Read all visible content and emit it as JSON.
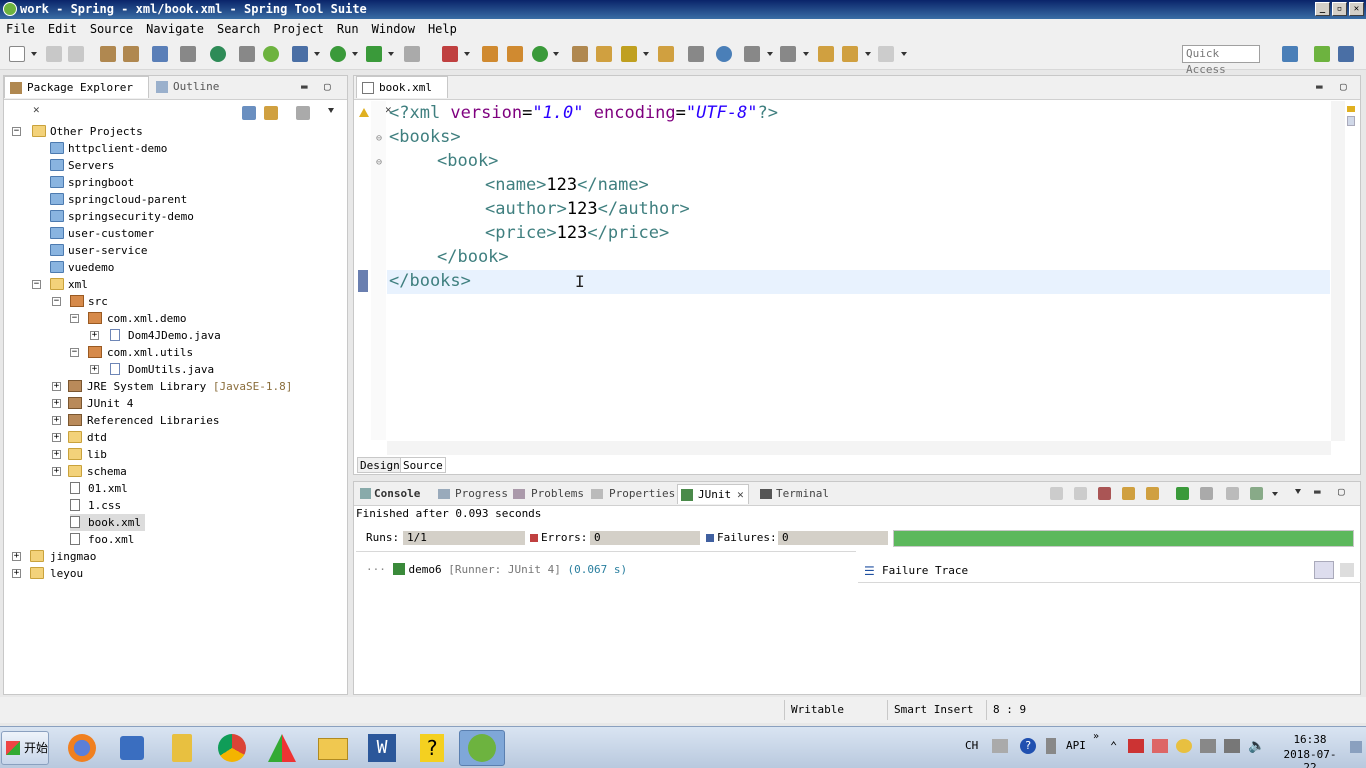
{
  "window": {
    "title": "work - Spring - xml/book.xml - Spring Tool Suite"
  },
  "menu": [
    "File",
    "Edit",
    "Source",
    "Navigate",
    "Search",
    "Project",
    "Run",
    "Window",
    "Help"
  ],
  "toolbar": {
    "quick_access_placeholder": "Quick Access"
  },
  "package_explorer": {
    "tab_label": "Package Explorer",
    "outline_label": "Outline",
    "tree": {
      "other_projects": "Other Projects",
      "httpclient": "httpclient-demo",
      "servers": "Servers",
      "springboot": "springboot",
      "springcloud": "springcloud-parent",
      "springsecurity": "springsecurity-demo",
      "user_customer": "user-customer",
      "user_service": "user-service",
      "vuedemo": "vuedemo",
      "xml": "xml",
      "src": "src",
      "pkg_demo": "com.xml.demo",
      "dom4j": "Dom4JDemo.java",
      "pkg_utils": "com.xml.utils",
      "domutils": "DomUtils.java",
      "jre": "JRE System Library",
      "jre_version": "[JavaSE-1.8]",
      "junit": "JUnit 4",
      "reflibs": "Referenced Libraries",
      "dtd": "dtd",
      "lib": "lib",
      "schema": "schema",
      "f01": "01.xml",
      "css": "1.css",
      "book": "book.xml",
      "foo": "foo.xml",
      "jingmao": "jingmao",
      "leyou": "leyou"
    }
  },
  "editor": {
    "tab_label": "book.xml",
    "lines": {
      "l1_open": "<?xml ",
      "l1_attr1": "version",
      "l1_eq1": "=",
      "l1_val1": "\"1.0\"",
      "l1_attr2": " encoding",
      "l1_eq2": "=",
      "l1_val2": "\"UTF-8\"",
      "l1_close": "?>",
      "l2": "<books>",
      "l3": "<book>",
      "l4_open": "<name>",
      "l4_text": "123",
      "l4_close": "</name>",
      "l5_open": "<author>",
      "l5_text": "123",
      "l5_close": "</author>",
      "l6_open": "<price>",
      "l6_text": "123",
      "l6_close": "</price>",
      "l7": "</book>",
      "l8": "</books>"
    },
    "design_tab": "Design",
    "source_tab": "Source"
  },
  "bottom_panel": {
    "tabs": [
      "Console",
      "Progress",
      "Problems",
      "Properties",
      "JUnit",
      "Terminal"
    ],
    "finished": "Finished after 0.093 seconds",
    "runs_label": "Runs:",
    "runs_value": "1/1",
    "errors_label": "Errors:",
    "errors_value": "0",
    "failures_label": "Failures:",
    "failures_value": "0",
    "progress_fraction": 1.0,
    "progress_color": "#5cb85c",
    "test_name": "demo6",
    "test_runner": "[Runner: JUnit 4]",
    "test_time": "(0.067 s)",
    "failure_trace": "Failure Trace"
  },
  "statusbar": {
    "writable": "Writable",
    "insert_mode": "Smart Insert",
    "position": "8 : 9"
  },
  "taskbar": {
    "start": "开始",
    "lang": "CH",
    "ime": "API",
    "time": "16:38",
    "date": "2018-07-22"
  }
}
